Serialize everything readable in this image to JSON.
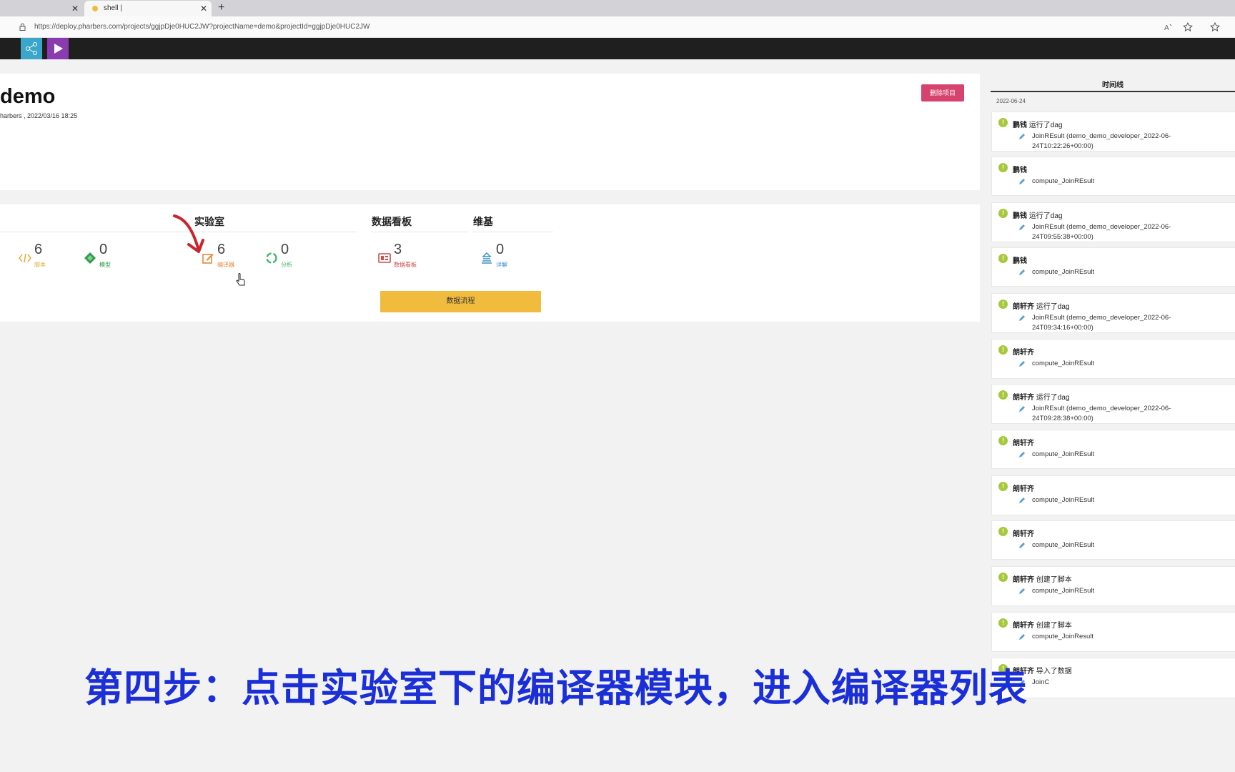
{
  "browser": {
    "tabs": [
      {
        "label": ""
      },
      {
        "label": "shell |"
      }
    ],
    "url_host": "https://deploy.pharbers.com",
    "url_rest": "/projects/ggjpDje0HUC2JW?projectName=demo&projectId=ggjpDje0HUC2JW"
  },
  "colors": {
    "accent_delete": "#d6436e",
    "flow_button": "#f1bc3e",
    "caption": "#1b2fd8",
    "dot": "#a6c83a"
  },
  "project": {
    "title": "demo",
    "subtitle": "harbers , 2022/03/16 18:25",
    "delete_label": "删除项目"
  },
  "sections": {
    "lab": "实验室",
    "dashboard": "数据看板",
    "wiki": "维基"
  },
  "stats": [
    {
      "num": "6",
      "label": "脚本",
      "icon": "code-icon"
    },
    {
      "num": "0",
      "label": "模型",
      "icon": "model-diamond-icon"
    },
    {
      "num": "6",
      "label": "编译器",
      "icon": "edit-icon"
    },
    {
      "num": "0",
      "label": "分析",
      "icon": "analysis-icon"
    },
    {
      "num": "3",
      "label": "数据看板",
      "icon": "dashboard-icon"
    },
    {
      "num": "0",
      "label": "详解",
      "icon": "wiki-icon"
    }
  ],
  "flow_button": "数据流程",
  "timeline": {
    "title": "时间线",
    "date": "2022-06-24",
    "items": [
      {
        "user": "鹏钱",
        "action": "运行了dag",
        "detail": "JoinREsult (demo_demo_developer_2022-06-24T10:22:26+00:00)"
      },
      {
        "user": "鹏钱",
        "action": "",
        "detail": "compute_JoinREsult"
      },
      {
        "user": "鹏钱",
        "action": "运行了dag",
        "detail": "JoinREsult (demo_demo_developer_2022-06-24T09:55:38+00:00)"
      },
      {
        "user": "鹏钱",
        "action": "",
        "detail": "compute_JoinREsult"
      },
      {
        "user": "朗轩齐",
        "action": "运行了dag",
        "detail": "JoinREsult (demo_demo_developer_2022-06-24T09:34:16+00:00)"
      },
      {
        "user": "朗轩齐",
        "action": "",
        "detail": "compute_JoinREsult"
      },
      {
        "user": "朗轩齐",
        "action": "运行了dag",
        "detail": "JoinREsult (demo_demo_developer_2022-06-24T09:28:38+00:00)"
      },
      {
        "user": "朗轩齐",
        "action": "",
        "detail": "compute_JoinREsult"
      },
      {
        "user": "朗轩齐",
        "action": "",
        "detail": "compute_JoinREsult"
      },
      {
        "user": "朗轩齐",
        "action": "",
        "detail": "compute_JoinREsult"
      },
      {
        "user": "朗轩齐",
        "action": "创建了脚本",
        "detail": "compute_JoinREsult"
      },
      {
        "user": "朗轩齐",
        "action": "创建了脚本",
        "detail": "compute_JoinResult"
      },
      {
        "user": "朗轩齐",
        "action": "导入了数据",
        "detail": "JoinC"
      }
    ]
  },
  "caption": "第四步：点击实验室下的编译器模块，进入编译器列表"
}
